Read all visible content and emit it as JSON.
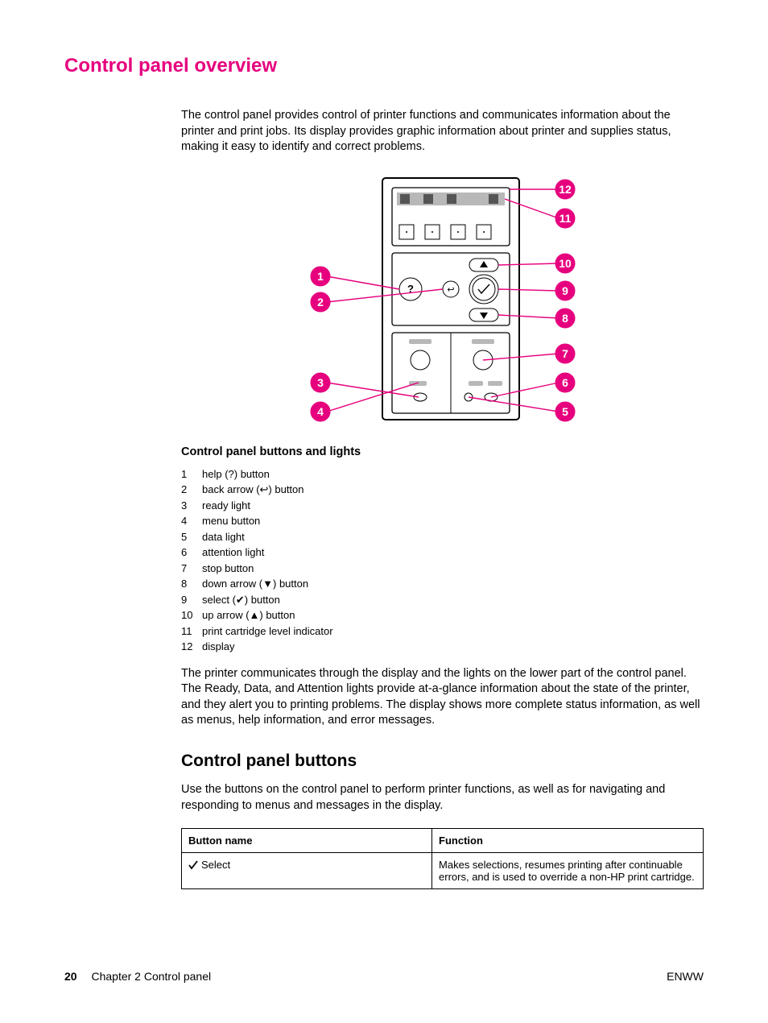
{
  "title": "Control panel overview",
  "intro": "The control panel provides control of printer functions and communicates information about the printer and print jobs. Its display provides graphic information about printer and supplies status, making it easy to identify and correct problems.",
  "legend_title": "Control panel buttons and lights",
  "legend": [
    {
      "n": "1",
      "t": "help (?) button"
    },
    {
      "n": "2",
      "t": "back arrow (↩) button"
    },
    {
      "n": "3",
      "t": "ready light"
    },
    {
      "n": "4",
      "t": "menu button"
    },
    {
      "n": "5",
      "t": "data light"
    },
    {
      "n": "6",
      "t": "attention light"
    },
    {
      "n": "7",
      "t": "stop button"
    },
    {
      "n": "8",
      "t": "down arrow (▼) button"
    },
    {
      "n": "9",
      "t": "select (✔) button"
    },
    {
      "n": "10",
      "t": "up arrow (▲) button"
    },
    {
      "n": "11",
      "t": "print cartridge level indicator"
    },
    {
      "n": "12",
      "t": "display"
    }
  ],
  "para2": "The printer communicates through the display and the lights on the lower part of the control panel. The Ready, Data, and Attention lights provide at-a-glance information about the state of the printer, and they alert you to printing problems. The display shows more complete status information, as well as menus, help information, and error messages.",
  "subhead": "Control panel buttons",
  "subpara": "Use the buttons on the control panel to perform printer functions, as well as for navigating and responding to menus and messages in the display.",
  "table": {
    "h1": "Button name",
    "h2": "Function",
    "rows": [
      {
        "name": "Select",
        "func": "Makes selections, resumes printing after continuable errors, and is used to override a non-HP print cartridge."
      }
    ]
  },
  "footer": {
    "page": "20",
    "chapter": "Chapter 2   Control panel",
    "right": "ENWW"
  },
  "callouts": [
    "1",
    "2",
    "3",
    "4",
    "5",
    "6",
    "7",
    "8",
    "9",
    "10",
    "11",
    "12"
  ]
}
